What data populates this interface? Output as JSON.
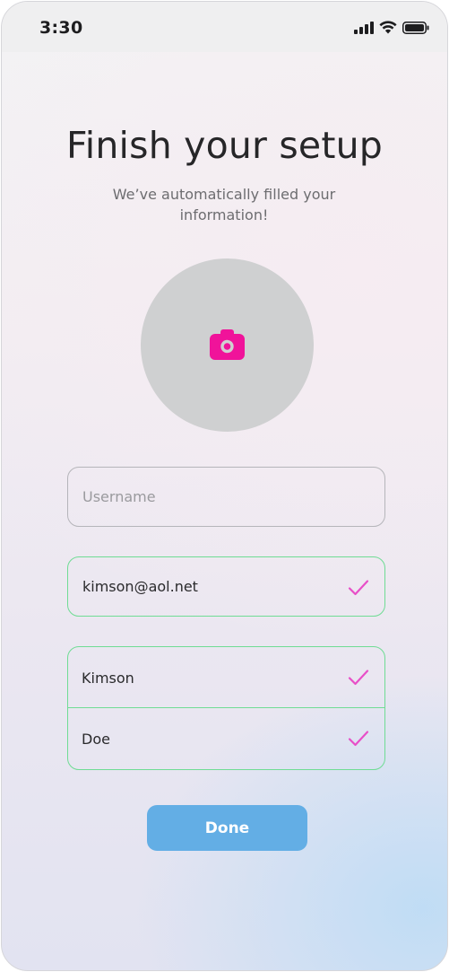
{
  "status_bar": {
    "time": "3:30",
    "icons": [
      "cellular-signal-icon",
      "wifi-icon",
      "battery-icon"
    ]
  },
  "header": {
    "title": "Finish your setup",
    "subtitle": "We’ve automatically filled your information!"
  },
  "avatar": {
    "icon": "camera-icon",
    "icon_color": "#f0139a",
    "background_color": "#cfd0d1"
  },
  "form": {
    "username": {
      "value": "",
      "placeholder": "Username"
    },
    "email": {
      "value": "kimson@aol.net",
      "valid": true
    },
    "first_name": {
      "value": "Kimson",
      "valid": true
    },
    "last_name": {
      "value": "Doe",
      "valid": true
    },
    "valid_border_color": "#6fdc94",
    "check_color": "#e84fc8"
  },
  "actions": {
    "done_label": "Done",
    "done_color": "#63aee5"
  }
}
